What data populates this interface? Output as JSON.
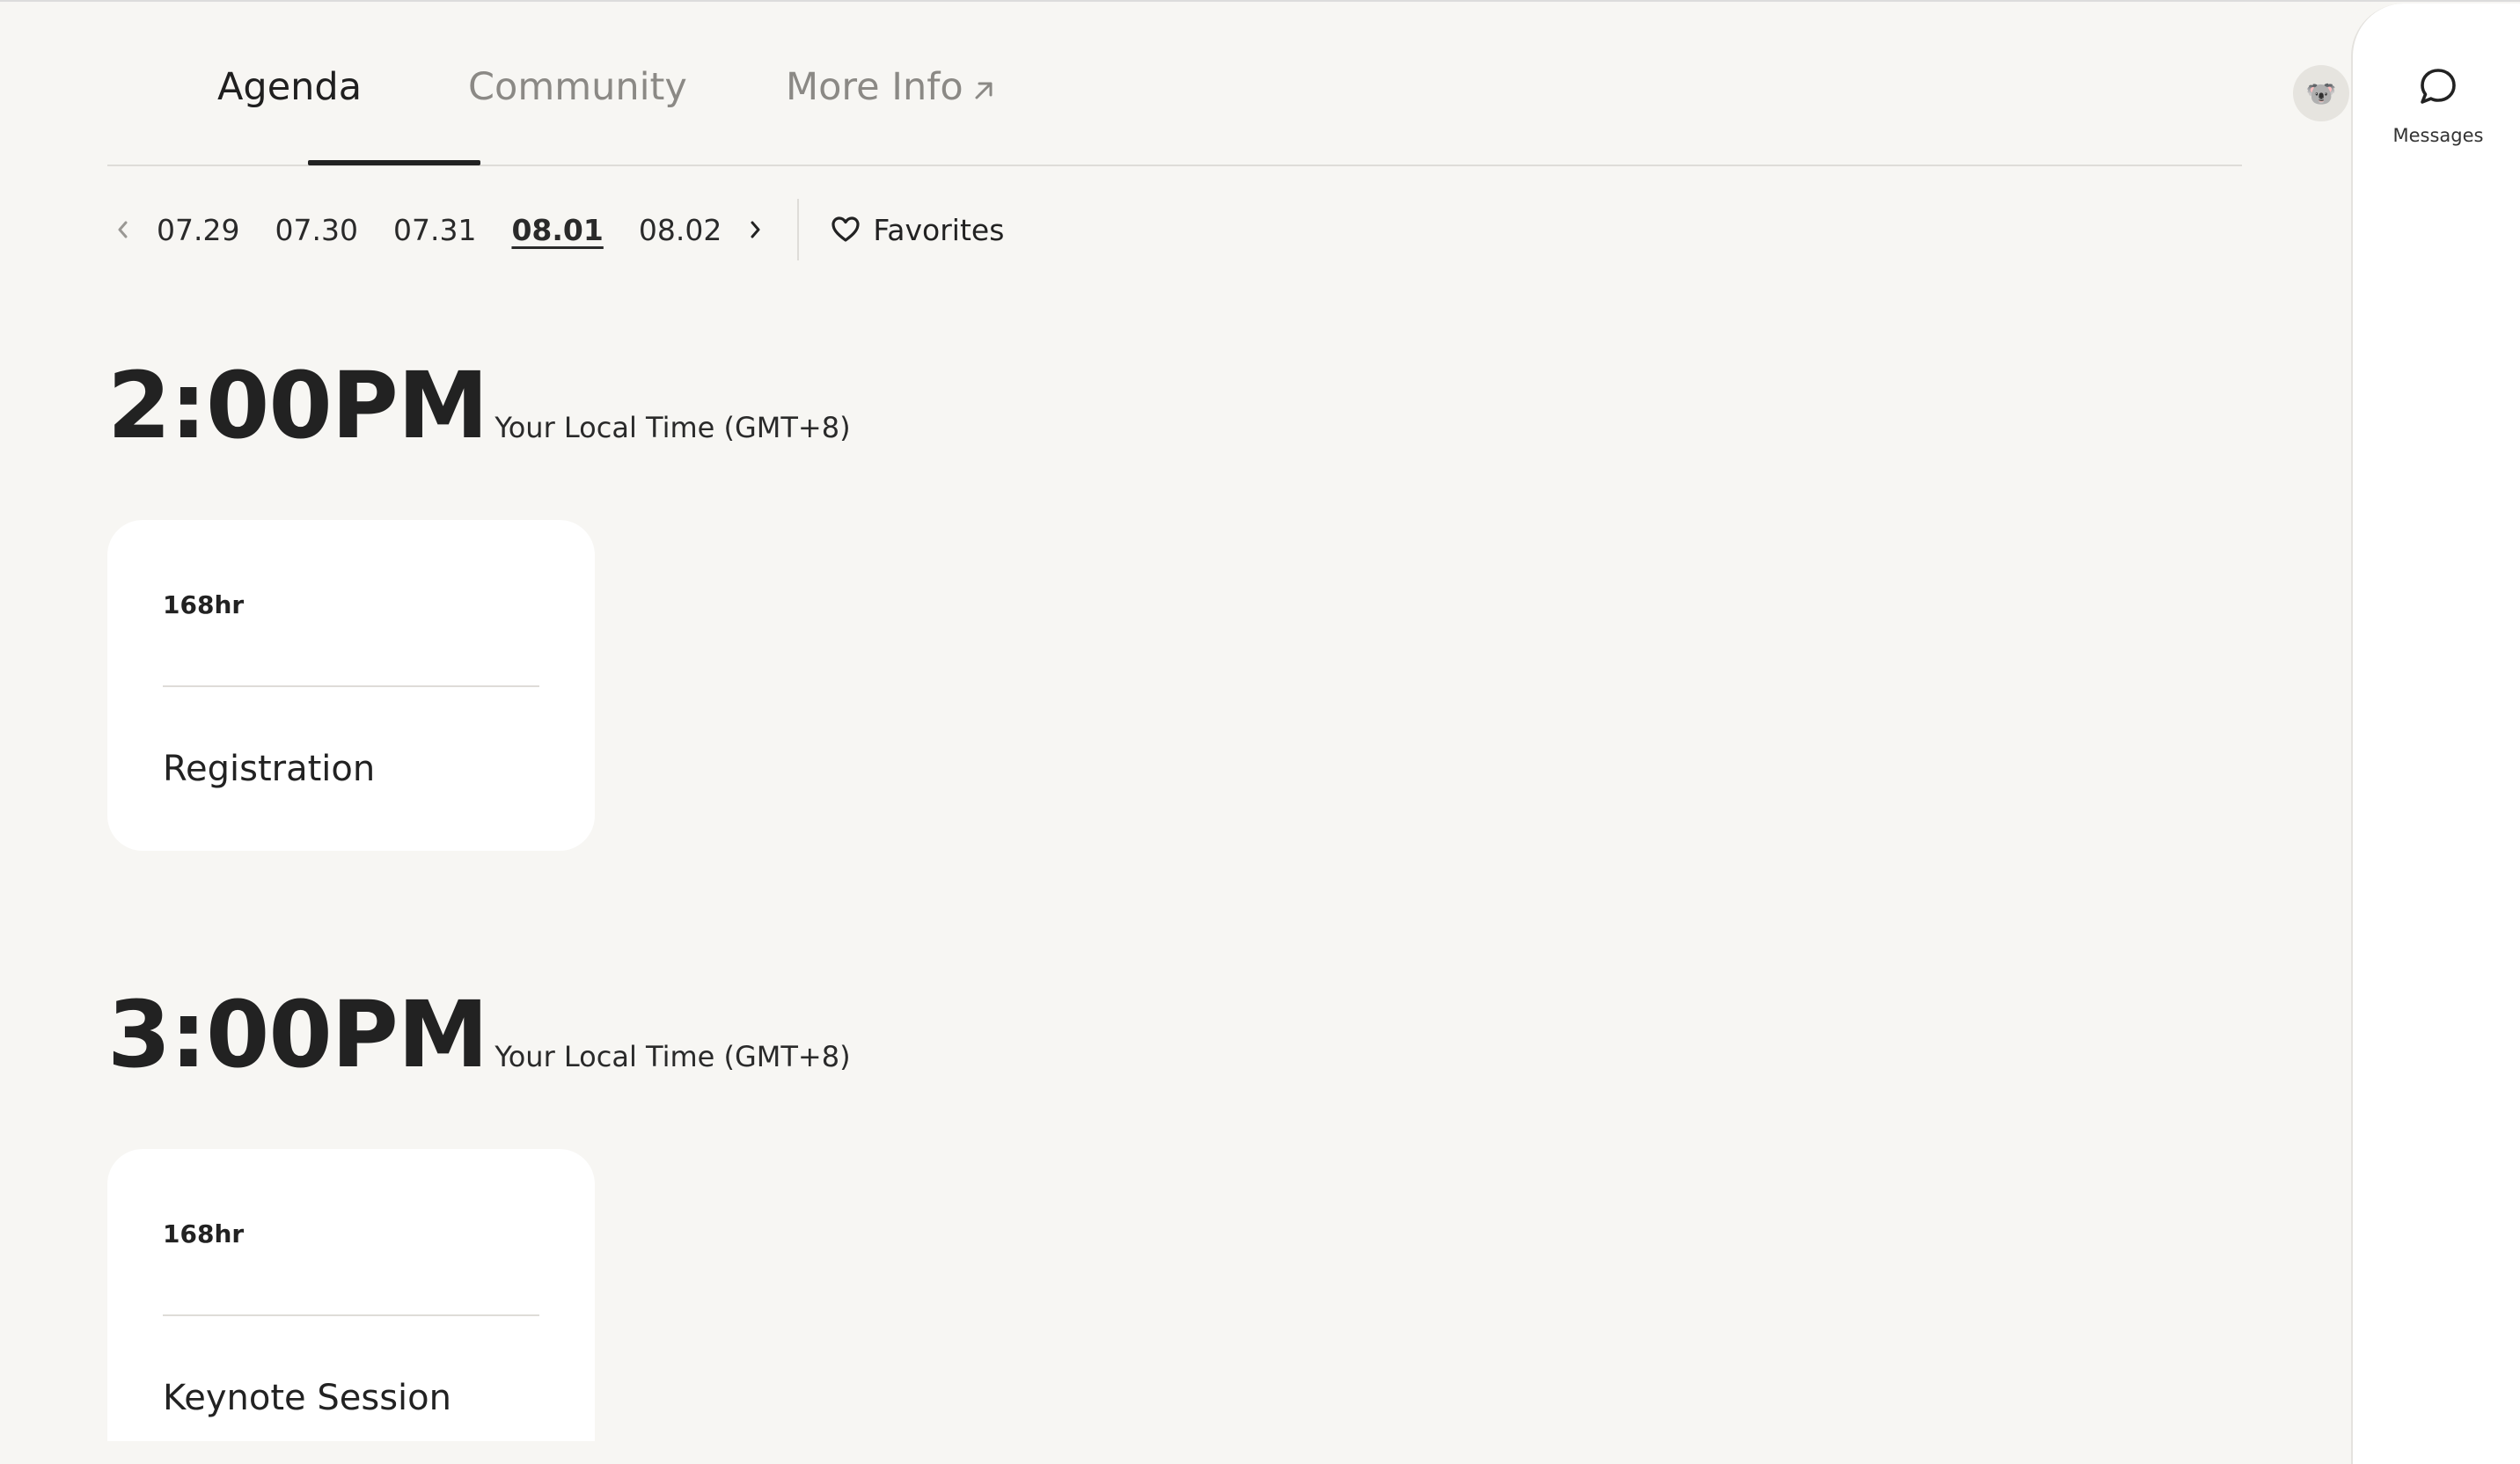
{
  "nav": {
    "tabs": [
      {
        "label": "Agenda",
        "active": true
      },
      {
        "label": "Community",
        "active": false
      },
      {
        "label": "More Info",
        "active": false,
        "external": true
      }
    ],
    "avatar_icon": "koala-avatar-icon"
  },
  "dates": {
    "items": [
      "07.29",
      "07.30",
      "07.31",
      "08.01",
      "08.02"
    ],
    "selected": "08.01",
    "favorites_label": "Favorites"
  },
  "schedule": [
    {
      "time": "2:00PM",
      "timezone_label": "Your Local Time (GMT+8)",
      "sessions": [
        {
          "duration": "168hr",
          "title": "Registration"
        }
      ]
    },
    {
      "time": "3:00PM",
      "timezone_label": "Your Local Time (GMT+8)",
      "sessions": [
        {
          "duration": "168hr",
          "title": "Keynote Session"
        }
      ]
    }
  ],
  "side_panel": {
    "messages_label": "Messages"
  },
  "colors": {
    "background": "#f7f6f3",
    "card": "#ffffff",
    "text": "#222222",
    "muted": "#8b8985",
    "divider": "#dedcd8"
  }
}
